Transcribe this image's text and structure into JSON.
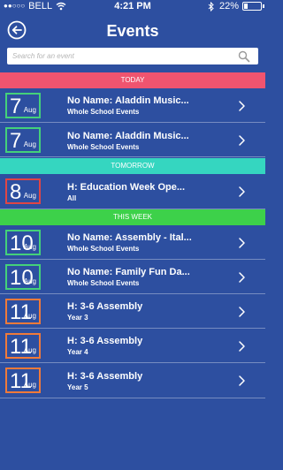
{
  "status_bar": {
    "signal": "●●○○○",
    "carrier": "BELL",
    "time": "4:21 PM",
    "battery_percent": "22%",
    "battery_level": 0.22
  },
  "header": {
    "title": "Events",
    "back_icon": "back-arrow-circle-icon"
  },
  "search": {
    "placeholder": "Search for an event",
    "icon": "search-icon"
  },
  "colors": {
    "background": "#2d4fa0",
    "today": "#f0546f",
    "tomorrow": "#35d6c0",
    "this_week": "#3dd14a",
    "box_green": "#44d17a",
    "box_red": "#e04545",
    "box_orange": "#f07a3a"
  },
  "sections": [
    {
      "label": "TODAY",
      "color": "#f0546f",
      "events": [
        {
          "day": "7",
          "month": "Aug",
          "title": "No Name: Aladdin Music...",
          "subtitle": "Whole School Events",
          "box_color": "#44d17a"
        },
        {
          "day": "7",
          "month": "Aug",
          "title": "No Name: Aladdin Music...",
          "subtitle": "Whole School Events",
          "box_color": "#44d17a"
        }
      ]
    },
    {
      "label": "TOMORROW",
      "color": "#35d6c0",
      "events": [
        {
          "day": "8",
          "month": "Aug",
          "title": "H: Education Week Ope...",
          "subtitle": "All",
          "box_color": "#e04545"
        }
      ]
    },
    {
      "label": "THIS WEEK",
      "color": "#3dd14a",
      "events": [
        {
          "day": "10",
          "month": "Aug",
          "title": "No Name: Assembly - Ital...",
          "subtitle": "Whole School Events",
          "box_color": "#44d17a"
        },
        {
          "day": "10",
          "month": "Aug",
          "title": "No Name: Family Fun Da...",
          "subtitle": "Whole School Events",
          "box_color": "#44d17a"
        },
        {
          "day": "11",
          "month": "Aug",
          "title": "H: 3-6 Assembly",
          "subtitle": "Year 3",
          "box_color": "#f07a3a"
        },
        {
          "day": "11",
          "month": "Aug",
          "title": "H: 3-6 Assembly",
          "subtitle": "Year 4",
          "box_color": "#f07a3a"
        },
        {
          "day": "11",
          "month": "Aug",
          "title": "H: 3-6 Assembly",
          "subtitle": "Year 5",
          "box_color": "#f07a3a"
        }
      ]
    }
  ]
}
